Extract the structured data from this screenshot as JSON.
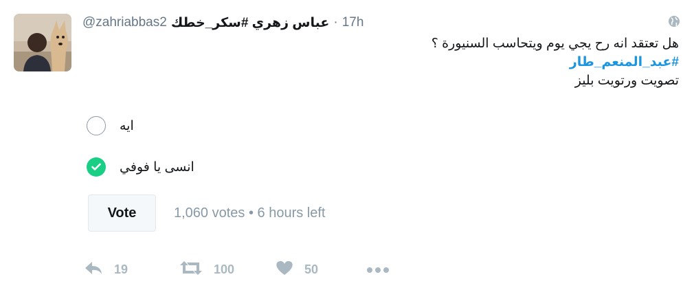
{
  "tweet": {
    "handle": "@zahriabbas2",
    "display_name": "عباس زهري #سكر_خطك",
    "separator": "·",
    "timestamp": "17h",
    "text_line1": "هل تعتقد انه رح يجي يوم ويتحاسب السنيورة ؟",
    "hashtag": "#عبد_المنعم_طار",
    "text_line3": "تصويت ورتويت بليز"
  },
  "poll": {
    "options": [
      {
        "label": "ايه",
        "selected": false
      },
      {
        "label": "انسى يا فوفي",
        "selected": true
      }
    ],
    "vote_label": "Vote",
    "meta": "1,060 votes • 6 hours left"
  },
  "actions": {
    "reply_count": "19",
    "retweet_count": "100",
    "like_count": "50"
  },
  "colors": {
    "hashtag": "#1b95e0",
    "selected": "#19cf86",
    "muted": "#aab8c2"
  },
  "icons": [
    "globe-icon",
    "reply-icon",
    "retweet-icon",
    "heart-icon",
    "more-icon",
    "checkmark-icon"
  ]
}
